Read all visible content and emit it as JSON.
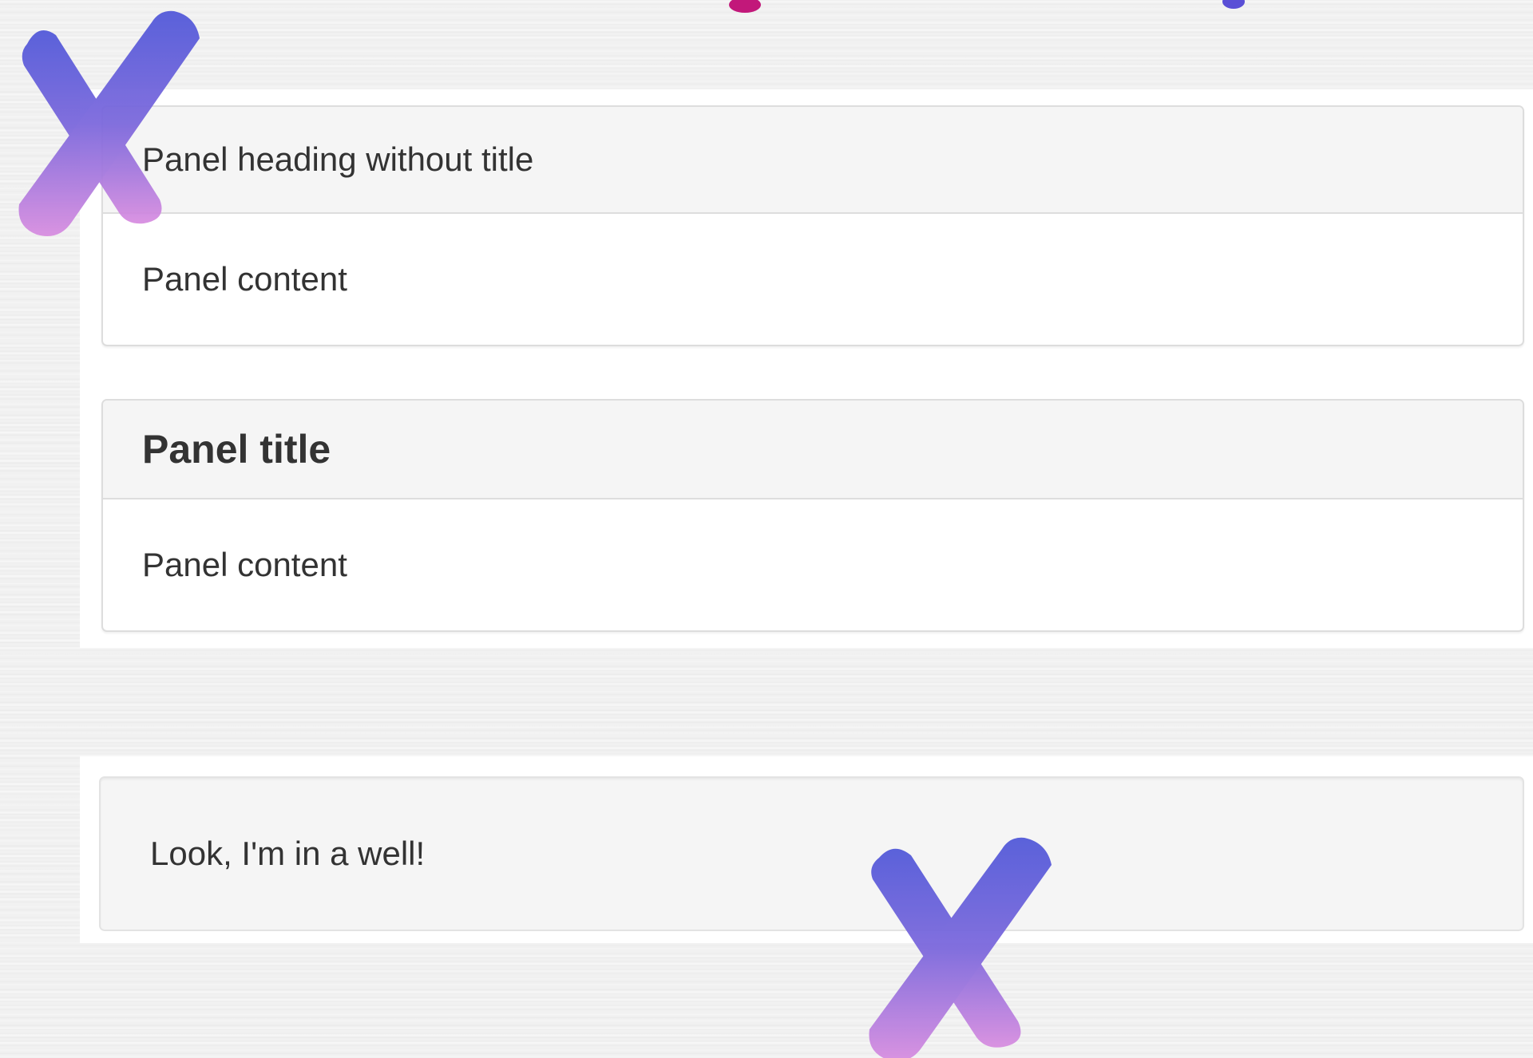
{
  "panels": [
    {
      "heading": "Panel heading without title",
      "body": "Panel content"
    },
    {
      "title": "Panel title",
      "body": "Panel content"
    }
  ],
  "well": {
    "text": "Look, I'm in a well!"
  },
  "colors": {
    "panel_border": "#dddddd",
    "panel_heading_bg": "#f5f5f5",
    "well_bg": "#f5f5f5",
    "text": "#333333",
    "x_mark_top": "#5b5bd6",
    "x_mark_bottom": "#d88ce0",
    "blot": "#c2187a"
  },
  "decorations": [
    "watercolor-x-icon",
    "watercolor-x-icon",
    "paint-blot-icon",
    "paint-blot-icon"
  ]
}
